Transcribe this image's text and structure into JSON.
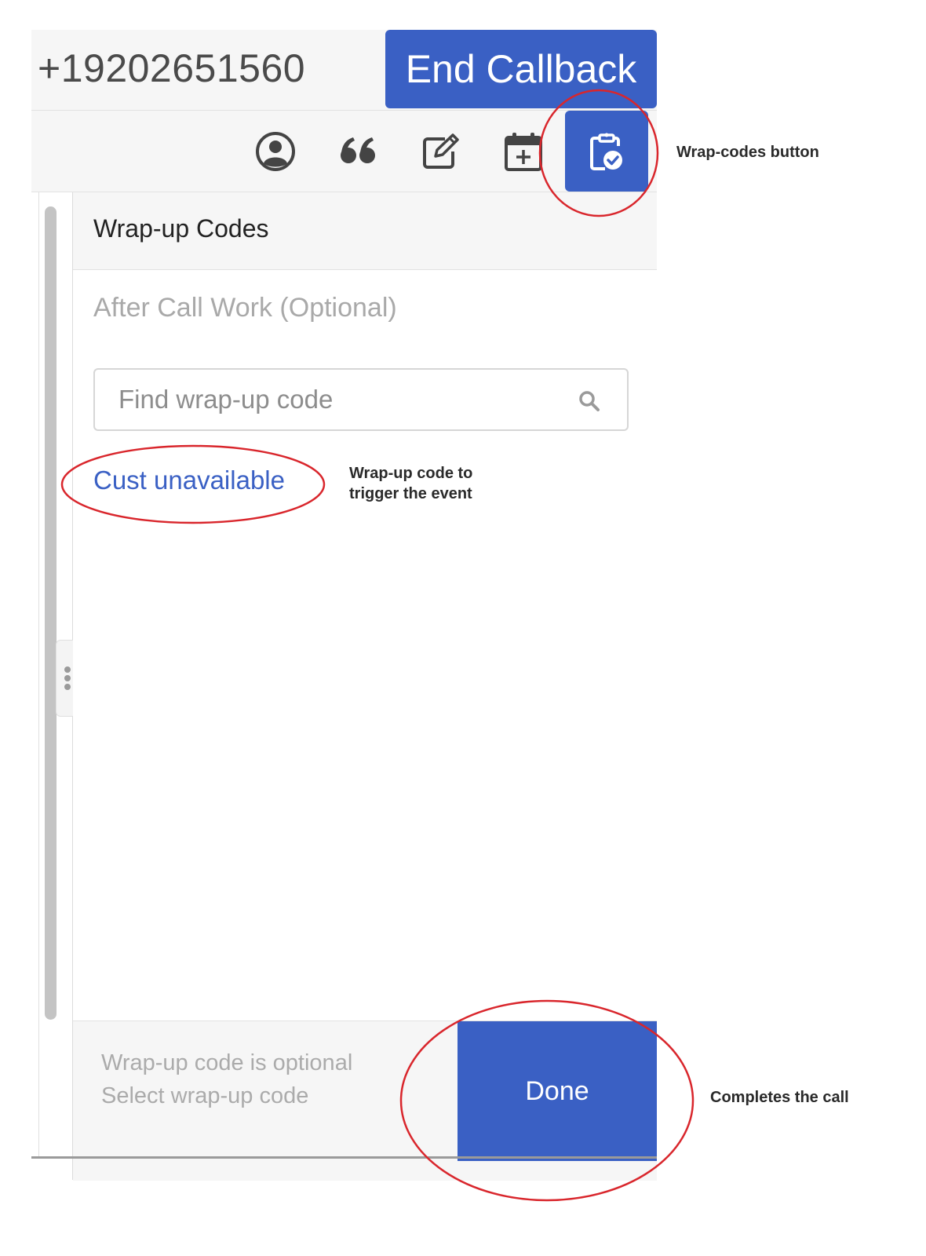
{
  "header": {
    "phone_number": "+19202651560",
    "end_button_label": "End Callback"
  },
  "toolbar": {
    "items": [
      {
        "name": "contact",
        "icon": "user-circle-icon"
      },
      {
        "name": "scripts",
        "icon": "quote-icon"
      },
      {
        "name": "notes",
        "icon": "edit-note-icon"
      },
      {
        "name": "schedule",
        "icon": "calendar-plus-icon"
      },
      {
        "name": "wrap-up",
        "icon": "clipboard-check-icon",
        "active": true
      }
    ]
  },
  "panel": {
    "title": "Wrap-up Codes",
    "subtitle": "After Call Work (Optional)",
    "search_placeholder": "Find wrap-up code",
    "codes": [
      "Cust unavailable"
    ]
  },
  "footer": {
    "line1": "Wrap-up code is optional",
    "line2": "Select wrap-up code",
    "done_label": "Done"
  },
  "annotations": {
    "wrap_codes_button": "Wrap-codes button",
    "wrap_code_line1": "Wrap-up code to",
    "wrap_code_line2": "trigger the event",
    "completes_call": "Completes the call",
    "circle_color": "#d9262c"
  },
  "colors": {
    "accent": "#3a60c4",
    "header_bg": "#f6f6f6",
    "muted_text": "#a9a9a9"
  }
}
